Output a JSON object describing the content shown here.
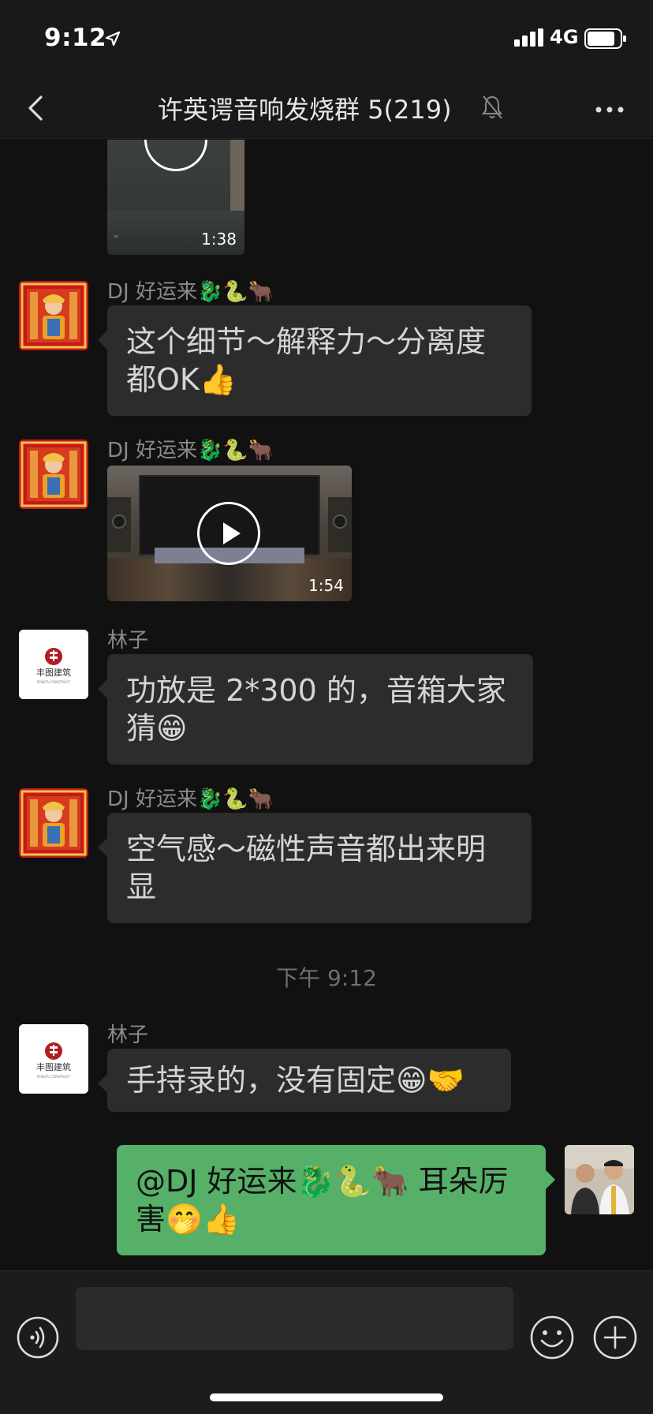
{
  "status_bar": {
    "time": "9:12",
    "network": "4G"
  },
  "nav": {
    "title": "许英谔音响发烧群 5(219)"
  },
  "messages": [
    {
      "type": "video",
      "sender": "",
      "duration": "1:38"
    },
    {
      "type": "text",
      "sender": "DJ 好运来🐉🐍🐂",
      "text": "这个细节～解释力～分离度都OK👍"
    },
    {
      "type": "video",
      "sender": "DJ 好运来🐉🐍🐂",
      "duration": "1:54"
    },
    {
      "type": "text",
      "sender": "林子",
      "text": "功放是 2*300 的，音箱大家猜😁"
    },
    {
      "type": "text",
      "sender": "DJ 好运来🐉🐍🐂",
      "text": "空气感～磁性声音都出来明显"
    },
    {
      "type": "timestamp",
      "text": "下午 9:12"
    },
    {
      "type": "text",
      "sender": "林子",
      "text": "手持录的，没有固定😁🤝"
    },
    {
      "type": "text",
      "sender": "me",
      "text": "@DJ 好运来🐉🐍🐂 耳朵厉害🤭👍"
    }
  ],
  "avatars": {
    "lin_logo_text": "丰图建筑",
    "lin_logo_sub": "FENGTU CONSTRUCT"
  },
  "input": {
    "value": "",
    "placeholder": ""
  },
  "icons": {
    "back": "chevron-left-icon",
    "mute": "bell-muted-icon",
    "more": "more-dots-icon",
    "voice": "voice-icon",
    "emoji": "emoji-icon",
    "plus": "plus-icon"
  },
  "colors": {
    "background": "#111111",
    "bar": "#191919",
    "bubble_in": "#2c2c2c",
    "bubble_out": "#56b068"
  }
}
